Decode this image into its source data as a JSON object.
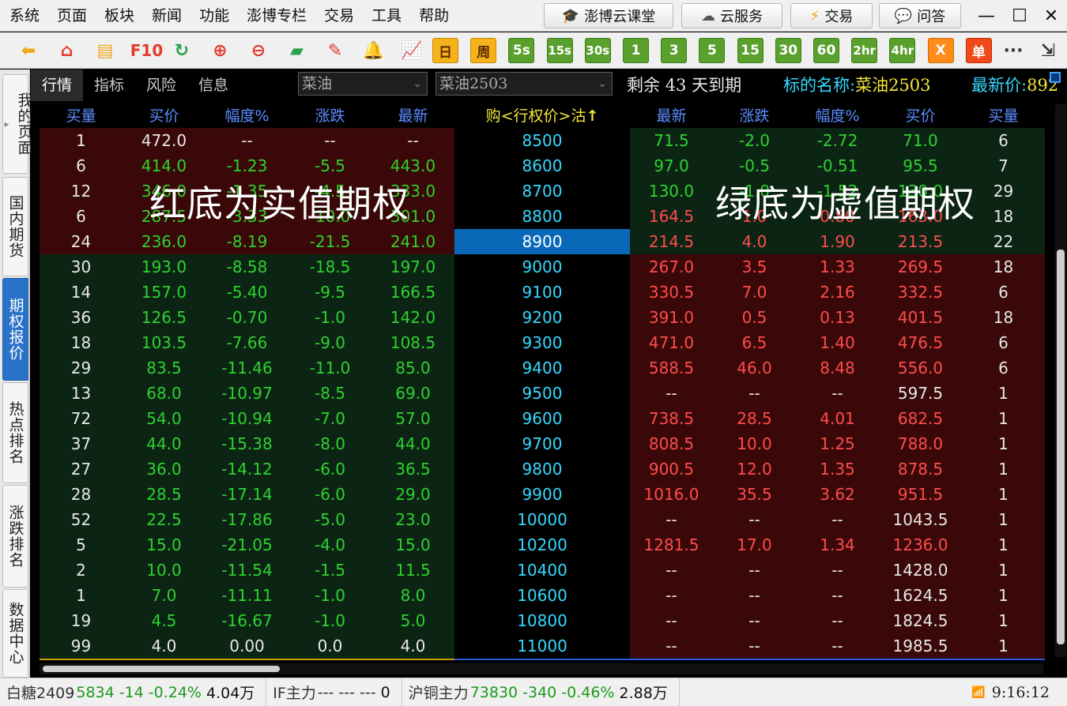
{
  "menu": [
    "系统",
    "页面",
    "板块",
    "新闻",
    "功能",
    "澎博专栏",
    "交易",
    "工具",
    "帮助"
  ],
  "right_buttons": [
    {
      "label": "澎博云课堂",
      "icon": "🎓"
    },
    {
      "label": "云服务",
      "icon": "☁"
    },
    {
      "label": "交易",
      "icon": "⚡"
    },
    {
      "label": "问答",
      "icon": "💬"
    }
  ],
  "window_controls": {
    "minimize": "—",
    "maximize": "☐",
    "close": "✕"
  },
  "toolbar": {
    "icons": [
      {
        "name": "back-icon",
        "glyph": "⬅",
        "color": "#f2a81d"
      },
      {
        "name": "home-icon",
        "glyph": "⌂",
        "color": "#e23b2b"
      },
      {
        "name": "notepad-icon",
        "glyph": "▤",
        "color": "#f2a81d"
      },
      {
        "name": "f10-icon",
        "glyph": "F10",
        "color": "#e23b2b"
      },
      {
        "name": "refresh-icon",
        "glyph": "↻",
        "color": "#2aa14a"
      },
      {
        "name": "zoom-in-icon",
        "glyph": "⊕",
        "color": "#e23b2b"
      },
      {
        "name": "zoom-out-icon",
        "glyph": "⊖",
        "color": "#e23b2b"
      },
      {
        "name": "window-icon",
        "glyph": "▰",
        "color": "#2aa14a"
      },
      {
        "name": "pen-icon",
        "glyph": "✎",
        "color": "#e23b2b"
      },
      {
        "name": "bell-icon",
        "glyph": "🔔",
        "color": "#f2a81d"
      },
      {
        "name": "chart-icon",
        "glyph": "📈",
        "color": "#e23b2b"
      }
    ],
    "periods": [
      "日",
      "周",
      "5s",
      "15s",
      "30s",
      "1",
      "3",
      "5",
      "15",
      "30",
      "60",
      "2hr",
      "4hr",
      "X",
      "单"
    ],
    "more": "···"
  },
  "sidebar": {
    "tabs": [
      {
        "label": "我的页面",
        "active": false,
        "has_arrow": true
      },
      {
        "label": "国内期货",
        "active": false
      },
      {
        "label": "期权报价",
        "active": true
      },
      {
        "label": "热点排名",
        "active": false
      },
      {
        "label": "涨跌排名",
        "active": false
      },
      {
        "label": "数据中心",
        "active": false
      }
    ]
  },
  "subtabs": [
    "行情",
    "指标",
    "风险",
    "信息"
  ],
  "selectors": {
    "commodity": "菜油",
    "contract": "菜油2503"
  },
  "info_bar": {
    "remaining_label": "剩余",
    "remaining_days": "43",
    "days_suffix": "天到期",
    "underlying_label": "标的名称:",
    "underlying_value": "菜油2503",
    "latest_label": "最新价:",
    "latest_value": "892"
  },
  "table": {
    "headers_left": [
      "买量",
      "买价",
      "幅度%",
      "涨跌",
      "最新"
    ],
    "header_center": "购<行权价>沽",
    "sort_arrow": "↑",
    "headers_right": [
      "最新",
      "涨跌",
      "幅度%",
      "买价",
      "买量"
    ],
    "atm_strike": "8900",
    "rows": [
      {
        "strike": "8500",
        "call": [
          "1",
          "472.0",
          "--",
          "--",
          "--"
        ],
        "put": [
          "71.5",
          "-2.0",
          "-2.72",
          "71.0",
          "6"
        ]
      },
      {
        "strike": "8600",
        "call": [
          "6",
          "414.0",
          "-1.23",
          "-5.5",
          "443.0"
        ],
        "put": [
          "97.0",
          "-0.5",
          "-0.51",
          "95.5",
          "7"
        ]
      },
      {
        "strike": "8700",
        "call": [
          "12",
          "346.0",
          "-1.35",
          "-4.5",
          "333.0"
        ],
        "put": [
          "130.0",
          "-1.0",
          "-1.52",
          "130.0",
          "29"
        ]
      },
      {
        "strike": "8800",
        "call": [
          "6",
          "287.5",
          "-3.33",
          "-10.0",
          "301.0"
        ],
        "put": [
          "164.5",
          "1.0",
          "0.80",
          "163.0",
          "18"
        ]
      },
      {
        "strike": "8900",
        "call": [
          "24",
          "236.0",
          "-8.19",
          "-21.5",
          "241.0"
        ],
        "put": [
          "214.5",
          "4.0",
          "1.90",
          "213.5",
          "22"
        ]
      },
      {
        "strike": "9000",
        "call": [
          "30",
          "193.0",
          "-8.58",
          "-18.5",
          "197.0"
        ],
        "put": [
          "267.0",
          "3.5",
          "1.33",
          "269.5",
          "18"
        ]
      },
      {
        "strike": "9100",
        "call": [
          "14",
          "157.0",
          "-5.40",
          "-9.5",
          "166.5"
        ],
        "put": [
          "330.5",
          "7.0",
          "2.16",
          "332.5",
          "6"
        ]
      },
      {
        "strike": "9200",
        "call": [
          "36",
          "126.5",
          "-0.70",
          "-1.0",
          "142.0"
        ],
        "put": [
          "391.0",
          "0.5",
          "0.13",
          "401.5",
          "18"
        ]
      },
      {
        "strike": "9300",
        "call": [
          "18",
          "103.5",
          "-7.66",
          "-9.0",
          "108.5"
        ],
        "put": [
          "471.0",
          "6.5",
          "1.40",
          "476.5",
          "6"
        ]
      },
      {
        "strike": "9400",
        "call": [
          "29",
          "83.5",
          "-11.46",
          "-11.0",
          "85.0"
        ],
        "put": [
          "588.5",
          "46.0",
          "8.48",
          "556.0",
          "6"
        ]
      },
      {
        "strike": "9500",
        "call": [
          "13",
          "68.0",
          "-10.97",
          "-8.5",
          "69.0"
        ],
        "put": [
          "--",
          "--",
          "--",
          "597.5",
          "1"
        ]
      },
      {
        "strike": "9600",
        "call": [
          "72",
          "54.0",
          "-10.94",
          "-7.0",
          "57.0"
        ],
        "put": [
          "738.5",
          "28.5",
          "4.01",
          "682.5",
          "1"
        ]
      },
      {
        "strike": "9700",
        "call": [
          "37",
          "44.0",
          "-15.38",
          "-8.0",
          "44.0"
        ],
        "put": [
          "808.5",
          "10.0",
          "1.25",
          "788.0",
          "1"
        ]
      },
      {
        "strike": "9800",
        "call": [
          "27",
          "36.0",
          "-14.12",
          "-6.0",
          "36.5"
        ],
        "put": [
          "900.5",
          "12.0",
          "1.35",
          "878.5",
          "1"
        ]
      },
      {
        "strike": "9900",
        "call": [
          "28",
          "28.5",
          "-17.14",
          "-6.0",
          "29.0"
        ],
        "put": [
          "1016.0",
          "35.5",
          "3.62",
          "951.5",
          "1"
        ]
      },
      {
        "strike": "10000",
        "call": [
          "52",
          "22.5",
          "-17.86",
          "-5.0",
          "23.0"
        ],
        "put": [
          "--",
          "--",
          "--",
          "1043.5",
          "1"
        ]
      },
      {
        "strike": "10200",
        "call": [
          "5",
          "15.0",
          "-21.05",
          "-4.0",
          "15.0"
        ],
        "put": [
          "1281.5",
          "17.0",
          "1.34",
          "1236.0",
          "1"
        ]
      },
      {
        "strike": "10400",
        "call": [
          "2",
          "10.0",
          "-11.54",
          "-1.5",
          "11.5"
        ],
        "put": [
          "--",
          "--",
          "--",
          "1428.0",
          "1"
        ]
      },
      {
        "strike": "10600",
        "call": [
          "1",
          "7.0",
          "-11.11",
          "-1.0",
          "8.0"
        ],
        "put": [
          "--",
          "--",
          "--",
          "1624.5",
          "1"
        ]
      },
      {
        "strike": "10800",
        "call": [
          "19",
          "4.5",
          "-16.67",
          "-1.0",
          "5.0"
        ],
        "put": [
          "--",
          "--",
          "--",
          "1824.5",
          "1"
        ]
      },
      {
        "strike": "11000",
        "call": [
          "99",
          "4.0",
          "0.00",
          "0.0",
          "4.0"
        ],
        "put": [
          "--",
          "--",
          "--",
          "1985.5",
          "1"
        ]
      }
    ]
  },
  "annotations": {
    "left": "红底为实值期权",
    "right": "绿底为虚值期权"
  },
  "colors": {
    "itm_bg": "#3a0808",
    "otm_bg": "#0c2414",
    "up": "#ff4c4c",
    "down": "#2ed22e",
    "flat": "#e8e8e8",
    "strike": "#35d8ff",
    "header": "#5a8cff",
    "atm": "#0a68b8"
  },
  "statusbar": {
    "items": [
      {
        "name": "白糖2409",
        "price": "5834",
        "change": "-14",
        "pct": "-0.24%",
        "vol": "4.04万",
        "dir": "down"
      },
      {
        "name": "IF主力",
        "price": "---",
        "change": "---",
        "pct": "---",
        "vol": "0",
        "dir": "flat"
      },
      {
        "name": "沪铜主力",
        "price": "73830",
        "change": "-340",
        "pct": "-0.46%",
        "vol": "2.88万",
        "dir": "down"
      }
    ],
    "time": "9:16:12"
  }
}
